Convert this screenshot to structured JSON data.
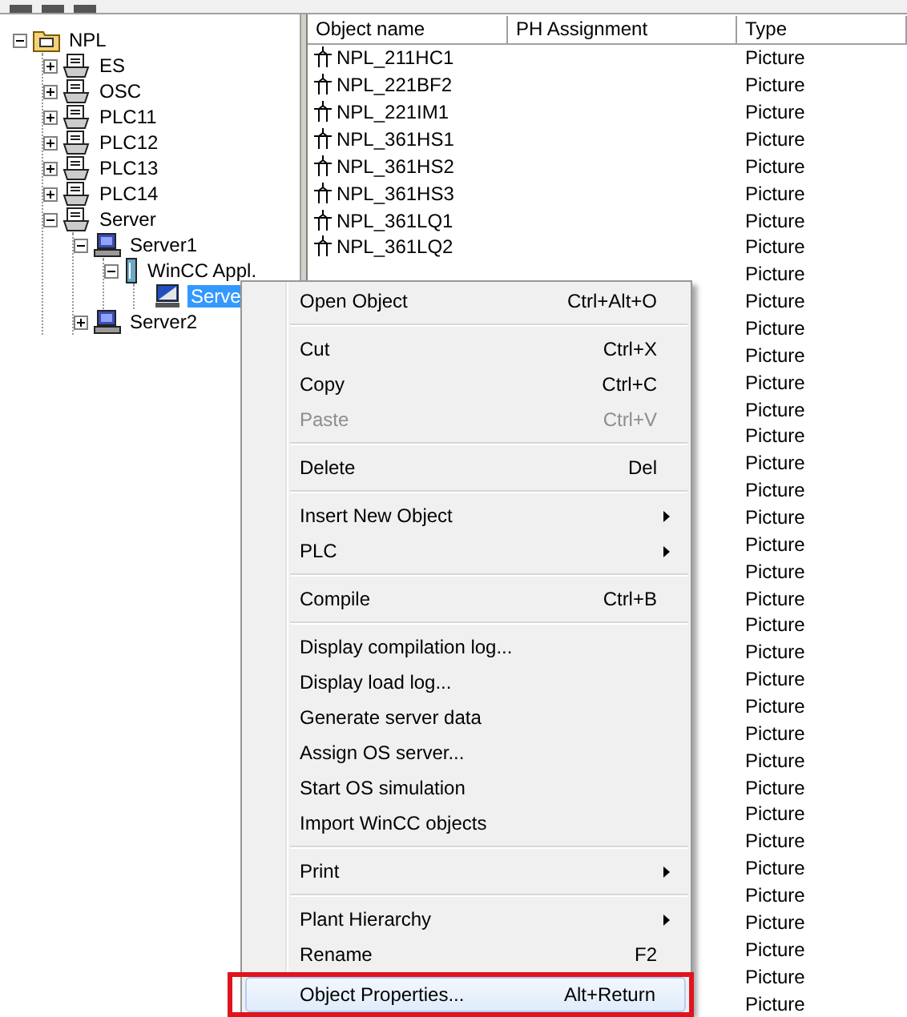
{
  "tree": [
    {
      "label": "NPL",
      "kind": "project",
      "expanded": true,
      "selected": false,
      "children": [
        {
          "label": "ES",
          "kind": "station",
          "expanded": false,
          "selected": false
        },
        {
          "label": "OSC",
          "kind": "station",
          "expanded": false,
          "selected": false
        },
        {
          "label": "PLC11",
          "kind": "station",
          "expanded": false,
          "selected": false
        },
        {
          "label": "PLC12",
          "kind": "station",
          "expanded": false,
          "selected": false
        },
        {
          "label": "PLC13",
          "kind": "station",
          "expanded": false,
          "selected": false
        },
        {
          "label": "PLC14",
          "kind": "station",
          "expanded": false,
          "selected": false
        },
        {
          "label": "Server",
          "kind": "station",
          "expanded": true,
          "selected": false,
          "children": [
            {
              "label": "Server1",
              "kind": "computer",
              "expanded": true,
              "selected": false,
              "children": [
                {
                  "label": "WinCC Appl.",
                  "kind": "application",
                  "expanded": true,
                  "selected": false,
                  "children": [
                    {
                      "label": "Serve",
                      "kind": "os",
                      "selected": true
                    }
                  ]
                }
              ]
            },
            {
              "label": "Server2",
              "kind": "computer",
              "expanded": false,
              "selected": false
            }
          ]
        }
      ]
    }
  ],
  "table": {
    "columns": [
      "Object name",
      "PH Assignment",
      "Type"
    ],
    "rows": [
      {
        "name": "NPL_211HC1",
        "type": "Picture"
      },
      {
        "name": "NPL_221BF2",
        "type": "Picture"
      },
      {
        "name": "NPL_221IM1",
        "type": "Picture"
      },
      {
        "name": "NPL_361HS1",
        "type": "Picture"
      },
      {
        "name": "NPL_361HS2",
        "type": "Picture"
      },
      {
        "name": "NPL_361HS3",
        "type": "Picture"
      },
      {
        "name": "NPL_361LQ1",
        "type": "Picture"
      },
      {
        "name": "NPL_361LQ2",
        "type": "Picture"
      },
      {
        "type": "Picture"
      },
      {
        "type": "Picture"
      },
      {
        "type": "Picture"
      },
      {
        "type": "Picture"
      },
      {
        "type": "Picture"
      },
      {
        "type": "Picture"
      },
      {
        "type": "Picture"
      },
      {
        "type": "Picture"
      },
      {
        "type": "Picture"
      },
      {
        "type": "Picture"
      },
      {
        "type": "Picture"
      },
      {
        "type": "Picture"
      },
      {
        "type": "Picture"
      },
      {
        "type": "Picture"
      },
      {
        "type": "Picture"
      },
      {
        "type": "Picture"
      },
      {
        "type": "Picture"
      },
      {
        "type": "Picture"
      },
      {
        "type": "Picture"
      },
      {
        "type": "Picture"
      },
      {
        "type": "Picture"
      },
      {
        "type": "Picture"
      },
      {
        "type": "Picture"
      },
      {
        "type": "Picture"
      },
      {
        "type": "Picture"
      },
      {
        "type": "Picture"
      },
      {
        "type": "Picture"
      },
      {
        "type": "Picture"
      }
    ]
  },
  "context_menu": [
    {
      "kind": "item",
      "label": "Open Object",
      "shortcut": "Ctrl+Alt+O"
    },
    {
      "kind": "separator"
    },
    {
      "kind": "item",
      "label": "Cut",
      "shortcut": "Ctrl+X"
    },
    {
      "kind": "item",
      "label": "Copy",
      "shortcut": "Ctrl+C"
    },
    {
      "kind": "item",
      "label": "Paste",
      "shortcut": "Ctrl+V",
      "disabled": true
    },
    {
      "kind": "separator"
    },
    {
      "kind": "item",
      "label": "Delete",
      "shortcut": "Del"
    },
    {
      "kind": "separator"
    },
    {
      "kind": "item",
      "label": "Insert New Object",
      "submenu": true
    },
    {
      "kind": "item",
      "label": "PLC",
      "submenu": true
    },
    {
      "kind": "separator"
    },
    {
      "kind": "item",
      "label": "Compile",
      "shortcut": "Ctrl+B"
    },
    {
      "kind": "separator"
    },
    {
      "kind": "item",
      "label": "Display compilation log..."
    },
    {
      "kind": "item",
      "label": "Display load log..."
    },
    {
      "kind": "item",
      "label": "Generate server data"
    },
    {
      "kind": "item",
      "label": "Assign OS server..."
    },
    {
      "kind": "item",
      "label": "Start OS simulation"
    },
    {
      "kind": "item",
      "label": "Import WinCC objects"
    },
    {
      "kind": "separator"
    },
    {
      "kind": "item",
      "label": "Print",
      "submenu": true
    },
    {
      "kind": "separator"
    },
    {
      "kind": "item",
      "label": "Plant Hierarchy",
      "submenu": true
    },
    {
      "kind": "item",
      "label": "Rename",
      "shortcut": "F2"
    },
    {
      "kind": "item",
      "label": "Object Properties...",
      "shortcut": "Alt+Return",
      "highlighted": true
    }
  ]
}
